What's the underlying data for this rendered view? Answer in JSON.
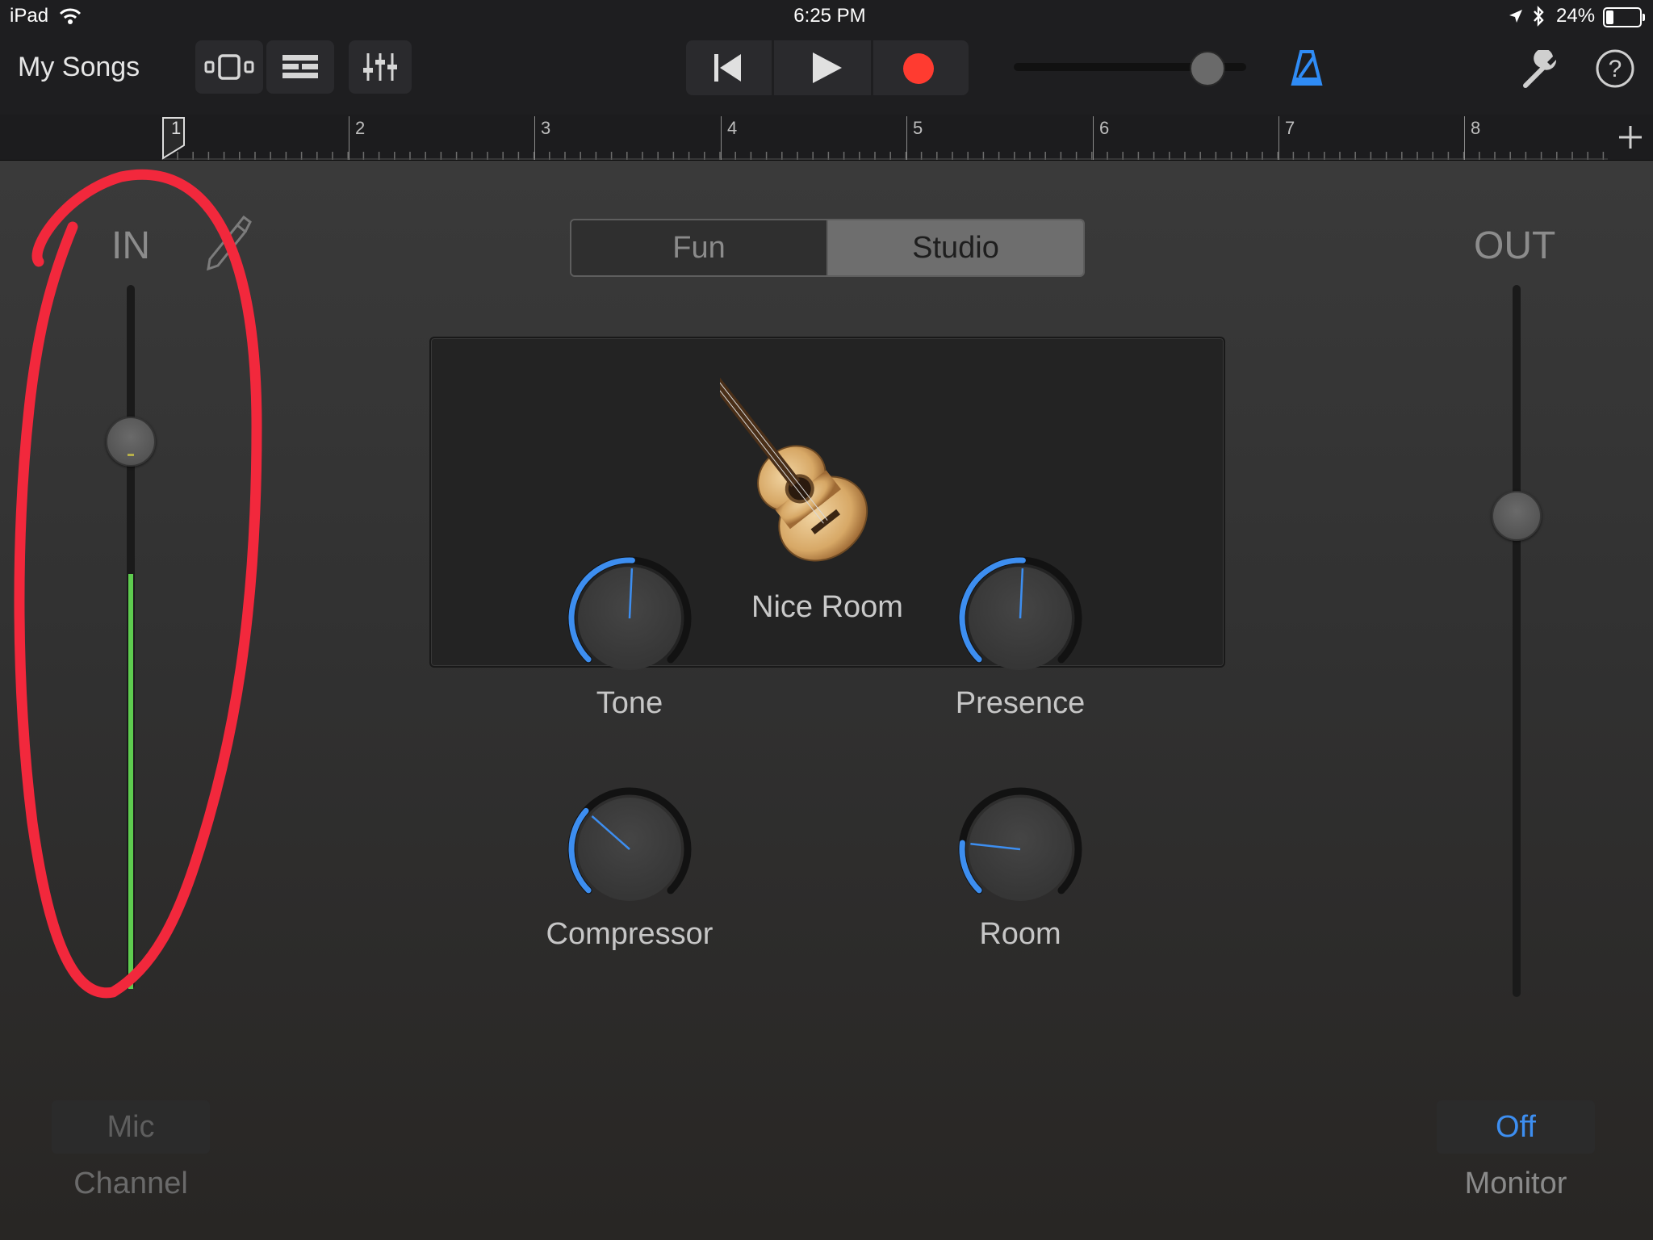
{
  "status_bar": {
    "device": "iPad",
    "time": "6:25 PM",
    "battery_percent": "24%",
    "battery_level": 0.24,
    "icons": [
      "wifi-icon",
      "location-icon",
      "bluetooth-icon",
      "battery-icon"
    ]
  },
  "toolbar": {
    "my_songs": "My Songs",
    "buttons": [
      "browser-view-icon",
      "tracks-view-icon",
      "mixer-controls-icon",
      "rewind-icon",
      "play-icon",
      "record-icon",
      "metronome-icon",
      "wrench-icon",
      "help-icon"
    ],
    "master_volume_level": 0.88,
    "colors": {
      "record": "#ff3b30",
      "metronome": "#2f8cf6"
    }
  },
  "ruler": {
    "bars": [
      "1",
      "2",
      "3",
      "4",
      "5",
      "6",
      "7",
      "8"
    ]
  },
  "input": {
    "label": "IN",
    "level_thumb": 0.8,
    "meter_level": 0.59,
    "meter_color": "#5ecc4f",
    "channel_value": "Mic",
    "channel_label": "Channel"
  },
  "mode": {
    "options": [
      "Fun",
      "Studio"
    ],
    "selected": "Studio"
  },
  "preset": {
    "name": "Nice Room"
  },
  "knobs": [
    {
      "label": "Tone",
      "value": 0.51
    },
    {
      "label": "Presence",
      "value": 0.51
    },
    {
      "label": "Compressor",
      "value": 0.32
    },
    {
      "label": "Room",
      "value": 0.19
    }
  ],
  "output": {
    "label": "OUT",
    "level": 0.69,
    "monitor_value": "Off",
    "monitor_label": "Monitor",
    "monitor_color": "#3d8ef0"
  },
  "annotation": {
    "color": "#f2283c"
  }
}
